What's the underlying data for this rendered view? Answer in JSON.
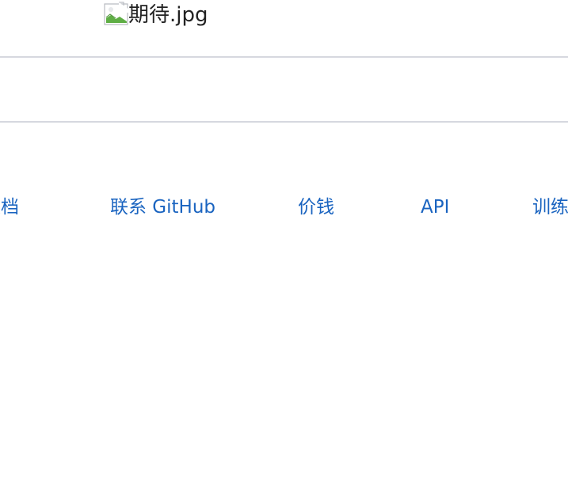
{
  "header": {
    "image_alt": "期待.jpg",
    "image_icon": "broken-image-icon"
  },
  "nav": {
    "links": [
      {
        "label": "文档"
      },
      {
        "label": "联系 GitHub"
      },
      {
        "label": "价钱"
      },
      {
        "label": "API"
      },
      {
        "label": "训练"
      }
    ]
  },
  "colors": {
    "link": "#1a64c0",
    "divider": "#d6d8df",
    "text": "#222222",
    "background": "#ffffff"
  }
}
